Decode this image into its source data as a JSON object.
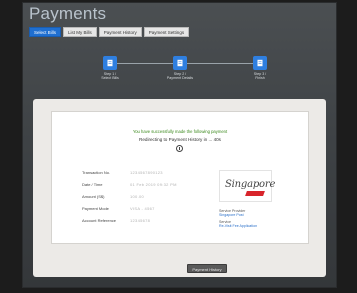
{
  "page": {
    "title": "Payments"
  },
  "tabs": [
    {
      "label": "Select Bills",
      "active": true
    },
    {
      "label": "List My Bills",
      "active": false
    },
    {
      "label": "Payment History",
      "active": false
    },
    {
      "label": "Payment Settings",
      "active": false
    }
  ],
  "steps": [
    {
      "label_line1": "Step 1 /",
      "label_line2": "Select Bills",
      "icon": "document-icon"
    },
    {
      "label_line1": "Step 2 /",
      "label_line2": "Payment Details",
      "icon": "document-icon"
    },
    {
      "label_line1": "Step 3 /",
      "label_line2": "Finish",
      "icon": "document-icon"
    }
  ],
  "confirmation": {
    "success_message": "You have successfully made the following payment",
    "redirect_message": "Redirecting to Payment History in ... 40s",
    "fields": [
      {
        "label": "Transaction No.",
        "value": "1234567890123"
      },
      {
        "label": "Date / Time",
        "value": "01 Feb 2019 09:32 PM"
      },
      {
        "label": "Amount (S$)",
        "value": "100.00"
      },
      {
        "label": "Payment Mode",
        "value": "VISA - 4567"
      },
      {
        "label": "Account Reference",
        "value": "12345678"
      }
    ],
    "logo_text": "Singapore",
    "provider": {
      "provider_label": "Service Provider",
      "provider_value": "Singapore Post",
      "service_label": "Service",
      "service_value": "Re-Visit Fee Application"
    }
  },
  "actions": {
    "payment_history_label": "Payment History"
  },
  "colors": {
    "accent": "#1f6fd1",
    "success": "#3c8a1e",
    "link": "#2a6fc9",
    "logo_red": "#d8242b"
  }
}
